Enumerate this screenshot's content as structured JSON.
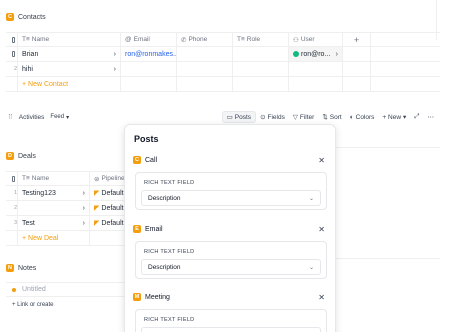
{
  "contacts": {
    "title": "Contacts",
    "columns": [
      "Name",
      "Email",
      "Phone",
      "Role",
      "User"
    ],
    "rows": [
      {
        "num": "",
        "name": "Brian",
        "email": "ron@ronmakes...",
        "user": "ron@ro..."
      },
      {
        "num": "2",
        "name": "hihi",
        "email": "",
        "user": ""
      }
    ],
    "add_label": "+ New Contact",
    "add_col": "+"
  },
  "activities": {
    "title": "Activities",
    "view": "Feed",
    "buttons": {
      "posts": "Posts",
      "fields": "Fields",
      "filter": "Filter",
      "sort": "Sort",
      "colors": "Colors",
      "new": "+ New"
    }
  },
  "deals": {
    "title": "Deals",
    "columns": [
      "Name",
      "Pipeline"
    ],
    "rows": [
      {
        "num": "1",
        "name": "Testing123",
        "pipeline": "Default"
      },
      {
        "num": "2",
        "name": "",
        "pipeline": "Default"
      },
      {
        "num": "3",
        "name": "Test",
        "pipeline": "Default"
      }
    ],
    "add_label": "+ New Deal"
  },
  "notes": {
    "title": "Notes",
    "items": [
      "Untitled"
    ],
    "link_label": "+ Link or create"
  },
  "posts_popup": {
    "title": "Posts",
    "sections": [
      {
        "badge": "C",
        "name": "Call",
        "field_label": "RICH TEXT FIELD",
        "select_value": "Description"
      },
      {
        "badge": "E",
        "name": "Email",
        "field_label": "RICH TEXT FIELD",
        "select_value": "Description"
      },
      {
        "badge": "M",
        "name": "Meeting",
        "field_label": "RICH TEXT FIELD",
        "select_value": ""
      }
    ]
  },
  "colors": {
    "accent": "#f59e0b",
    "link": "#2563eb"
  }
}
